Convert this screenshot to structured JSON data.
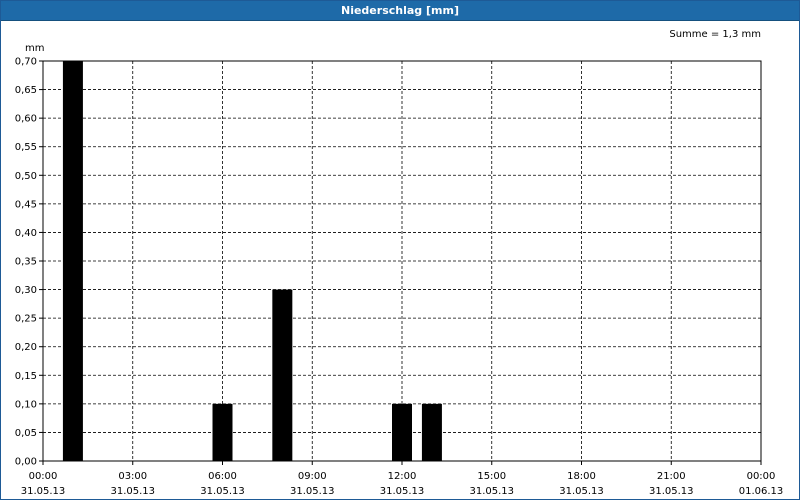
{
  "window": {
    "title": "Niederschlag [mm]"
  },
  "chart_data": {
    "type": "bar",
    "title": "Niederschlag [mm]",
    "summary_label": "Summe = 1,3 mm",
    "ylabel": "mm",
    "xlabel": "",
    "ylim": [
      0,
      0.7
    ],
    "y_ticks": [
      "0,00",
      "0,05",
      "0,10",
      "0,15",
      "0,20",
      "0,25",
      "0,30",
      "0,35",
      "0,40",
      "0,45",
      "0,50",
      "0,55",
      "0,60",
      "0,65",
      "0,70"
    ],
    "x_range_hours": [
      0,
      24
    ],
    "x_ticks": [
      {
        "time": "00:00",
        "date": "31.05.13"
      },
      {
        "time": "03:00",
        "date": "31.05.13"
      },
      {
        "time": "06:00",
        "date": "31.05.13"
      },
      {
        "time": "09:00",
        "date": "31.05.13"
      },
      {
        "time": "12:00",
        "date": "31.05.13"
      },
      {
        "time": "15:00",
        "date": "31.05.13"
      },
      {
        "time": "18:00",
        "date": "31.05.13"
      },
      {
        "time": "21:00",
        "date": "31.05.13"
      },
      {
        "time": "00:00",
        "date": "01.06.13"
      }
    ],
    "series": [
      {
        "color": "#000000",
        "points": [
          {
            "x": "01:00",
            "y": 0.7
          },
          {
            "x": "06:00",
            "y": 0.1
          },
          {
            "x": "08:00",
            "y": 0.3
          },
          {
            "x": "12:00",
            "y": 0.1
          },
          {
            "x": "13:00",
            "y": 0.1
          }
        ]
      }
    ],
    "grid": true
  }
}
